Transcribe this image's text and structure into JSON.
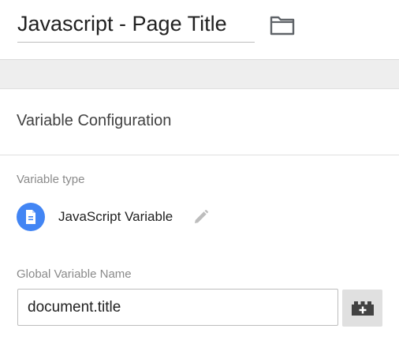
{
  "header": {
    "title_value": "Javascript - Page Title",
    "folder_icon": "folder-icon"
  },
  "configuration": {
    "section_title": "Variable Configuration",
    "variable_type_label": "Variable type",
    "variable_type_name": "JavaScript Variable",
    "variable_type_icon": "document-icon",
    "edit_icon": "pencil-icon",
    "global_variable_label": "Global Variable Name",
    "global_variable_value": "document.title",
    "variable_picker_icon": "lego-brick-add-icon"
  },
  "colors": {
    "accent_blue": "#4285f4",
    "gray_band": "#eeeeee",
    "label_gray": "#8a8a8a"
  }
}
